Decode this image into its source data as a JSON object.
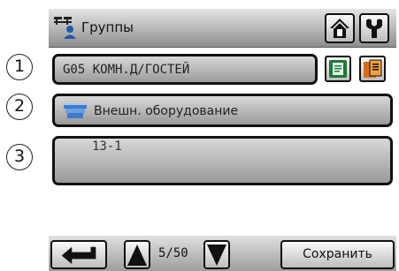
{
  "header": {
    "title": "Группы",
    "title_icon": "groups-icon",
    "home_icon": "home-icon",
    "settings_icon": "tools-icon"
  },
  "callouts": [
    "1",
    "2",
    "3"
  ],
  "group_name": {
    "value": "G05 КОМН.Д/ГОСТЕЙ",
    "edit_icon": "edit-list-icon",
    "select_icon": "select-list-icon"
  },
  "category": {
    "icon": "equipment-icon",
    "label": "Внешн. оборудование"
  },
  "members": {
    "value": "13-1"
  },
  "footer": {
    "back_icon": "return-arrow-icon",
    "up_icon": "triangle-up-icon",
    "down_icon": "triangle-down-icon",
    "page": "5/50",
    "save_label": "Сохранить"
  }
}
